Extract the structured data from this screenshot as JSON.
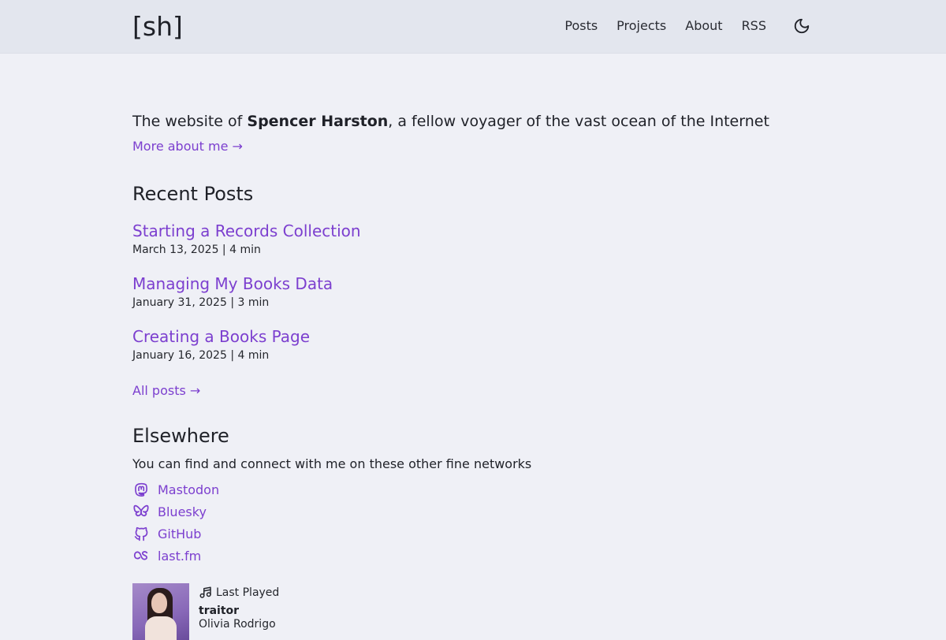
{
  "site": {
    "logo": "[sh]"
  },
  "nav": {
    "items": [
      {
        "label": "Posts"
      },
      {
        "label": "Projects"
      },
      {
        "label": "About"
      },
      {
        "label": "RSS"
      }
    ],
    "theme_toggle_icon": "moon-icon"
  },
  "intro": {
    "prefix": "The website of ",
    "name": "Spencer Harston",
    "suffix": ", a fellow voyager of the vast ocean of the Internet",
    "more_link": "More about me →"
  },
  "recent_posts": {
    "title": "Recent Posts",
    "posts": [
      {
        "title": "Starting a Records Collection",
        "meta": "March 13, 2025 | 4 min"
      },
      {
        "title": "Managing My Books Data",
        "meta": "January 31, 2025 | 3 min"
      },
      {
        "title": "Creating a Books Page",
        "meta": "January 16, 2025 | 4 min"
      }
    ],
    "all_posts_link": "All posts →"
  },
  "elsewhere": {
    "title": "Elsewhere",
    "description": "You can find and connect with me on these other fine networks",
    "networks": [
      {
        "label": "Mastodon",
        "icon": "mastodon-icon"
      },
      {
        "label": "Bluesky",
        "icon": "bluesky-icon"
      },
      {
        "label": "GitHub",
        "icon": "github-icon"
      },
      {
        "label": "last.fm",
        "icon": "lastfm-icon"
      }
    ]
  },
  "last_played": {
    "label": "Last Played",
    "track": "traitor",
    "artist": "Olivia Rodrigo"
  },
  "colors": {
    "accent": "#7c3fcf",
    "background": "#eff0f6",
    "header_background": "#e3e6ee"
  }
}
